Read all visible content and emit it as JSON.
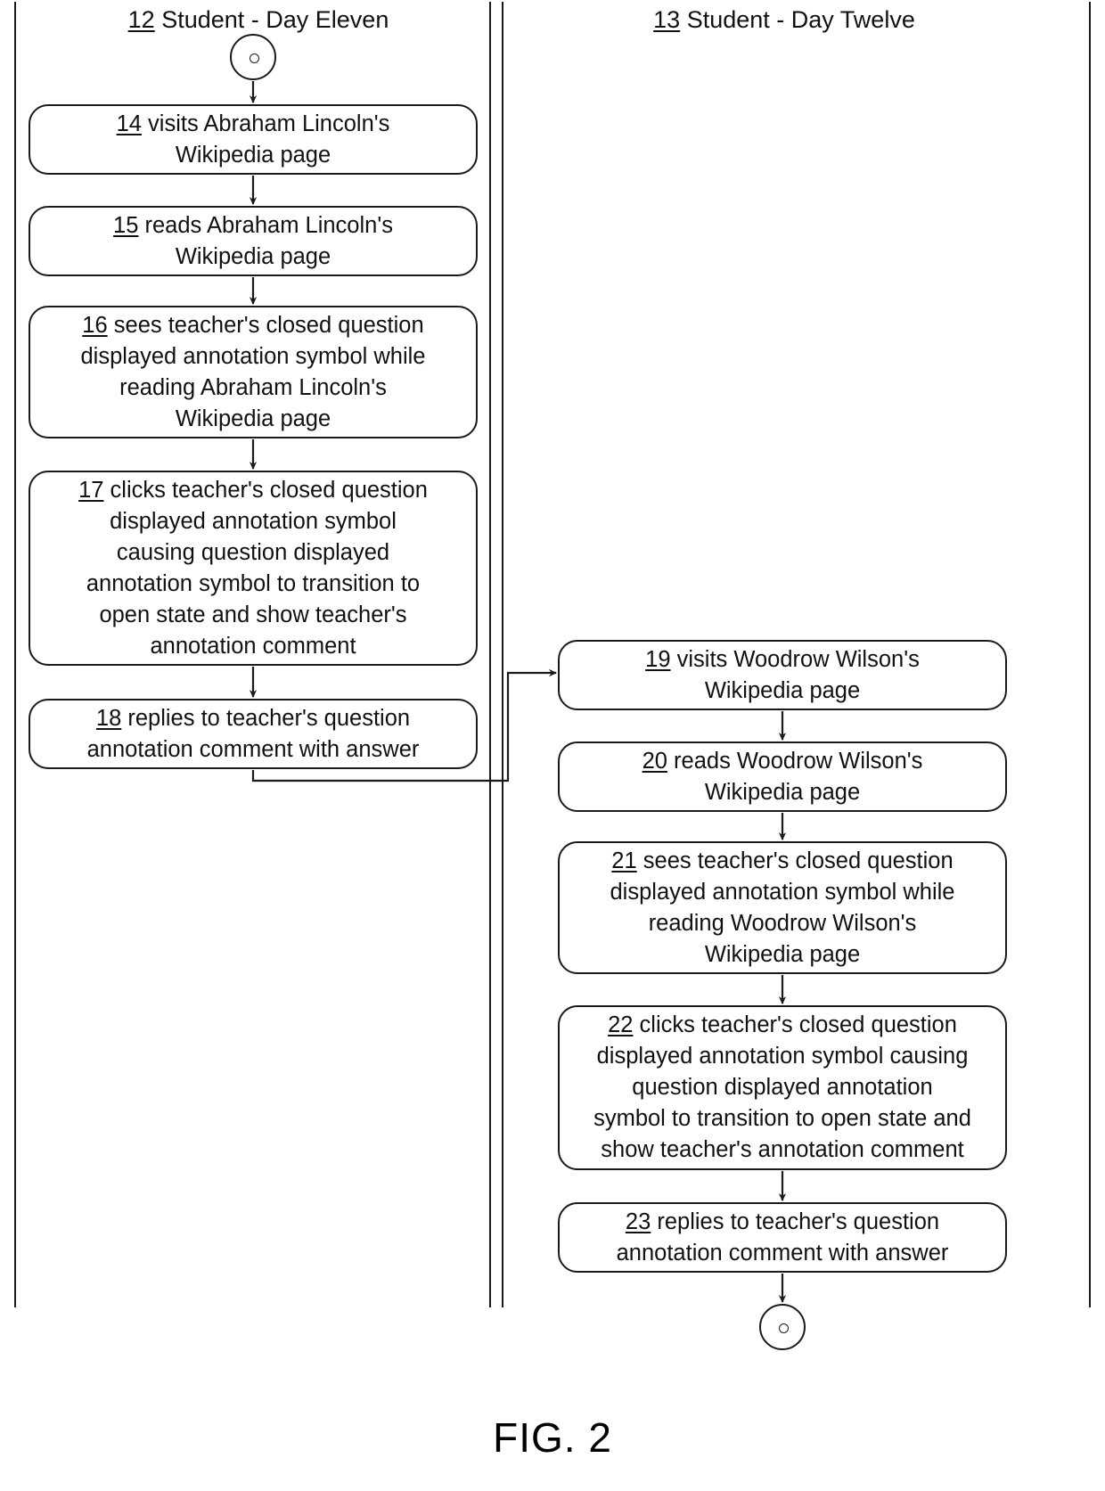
{
  "figure": {
    "caption": "FIG. 2"
  },
  "lanes": [
    {
      "id": "lane-left",
      "ref": "12",
      "title": " Student - Day Eleven"
    },
    {
      "id": "lane-right",
      "ref": "13",
      "title": " Student - Day Twelve"
    }
  ],
  "terminals": {
    "start_icon": "start-node-icon",
    "end_icon": "end-node-icon"
  },
  "nodes": {
    "n14": {
      "ref": "14",
      "text": " visits Abraham Lincoln's\nWikipedia page"
    },
    "n15": {
      "ref": "15",
      "text": " reads Abraham Lincoln's\nWikipedia page"
    },
    "n16": {
      "ref": "16",
      "text": " sees teacher's closed question\ndisplayed annotation symbol while\nreading Abraham Lincoln's\nWikipedia page"
    },
    "n17": {
      "ref": "17",
      "text": " clicks teacher's closed question\ndisplayed annotation symbol\ncausing  question displayed\nannotation symbol to transition to\nopen state and show teacher's\nannotation comment"
    },
    "n18": {
      "ref": "18",
      "text": " replies to teacher's question\nannotation comment with answer"
    },
    "n19": {
      "ref": "19",
      "text": " visits Woodrow Wilson's\nWikipedia page"
    },
    "n20": {
      "ref": "20",
      "text": " reads Woodrow Wilson's\nWikipedia page"
    },
    "n21": {
      "ref": "21",
      "text": " sees teacher's closed question\ndisplayed annotation symbol while\nreading Woodrow Wilson's\nWikipedia page"
    },
    "n22": {
      "ref": "22",
      "text": " clicks teacher's closed question\ndisplayed annotation symbol causing\nquestion displayed annotation\nsymbol to transition to open state and\nshow teacher's annotation comment"
    },
    "n23": {
      "ref": "23",
      "text": " replies to teacher's question\nannotation comment with answer"
    }
  },
  "colors": {
    "stroke": "#1a1a1a",
    "background": "#ffffff",
    "text": "#111111"
  }
}
